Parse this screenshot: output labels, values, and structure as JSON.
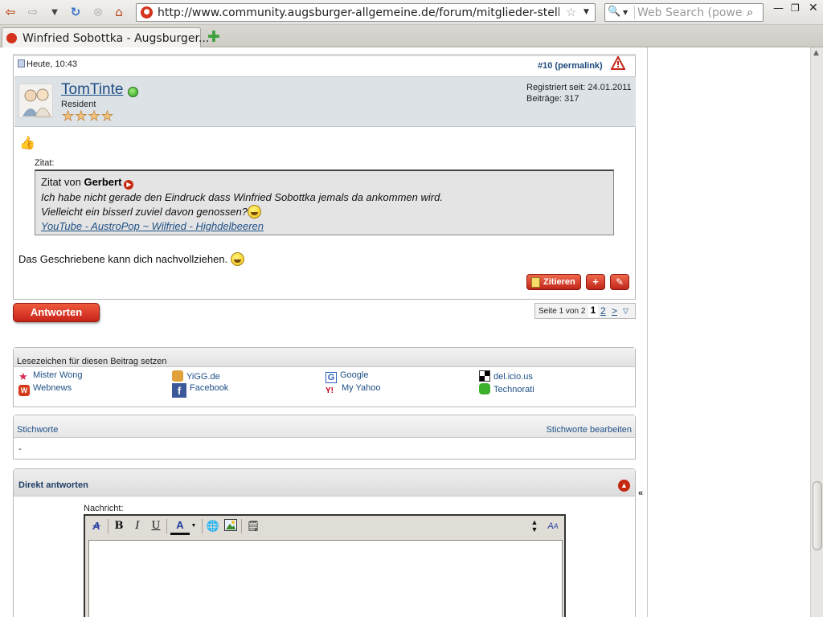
{
  "browser": {
    "url": "http://www.community.augsburger-allgemeine.de/forum/mitglieder-stellen-sich",
    "search_placeholder": "Web Search (powered",
    "tab_title": "Winfried Sobottka - Augsburger..."
  },
  "post": {
    "date": "Heute, 10:43",
    "number": "#10 (permalink)",
    "username": "TomTinte",
    "rank": "Resident",
    "stars": "★★★★",
    "registered": "Registriert seit: 24.01.2011",
    "posts": "Beiträge: 317",
    "quote_intro": "Zitat:",
    "quote_author_prefix": "Zitat von ",
    "quote_author": "Gerbert",
    "quote_line_1": "Ich habe nicht gerade den Eindruck dass Winfried Sobottka jemals da ankommen wird.",
    "quote_line_2": "Vielleicht ein bisserl zuviel davon genossen?",
    "quote_link": "YouTube - AustroPop ~ Wilfried - Highdelbeeren",
    "text": "Das Geschriebene kann dich nachvollziehen.",
    "quote_button": "Zitieren"
  },
  "reply_button": "Antworten",
  "pager": {
    "label": "Seite 1 von 2",
    "current": "1",
    "next_page": "2",
    "next": ">"
  },
  "bookmarks": {
    "title": "Lesezeichen für diesen Beitrag setzen",
    "items": [
      {
        "label": "Mister Wong",
        "icon": "mister-wong-icon",
        "color": "#d62a52"
      },
      {
        "label": "YiGG.de",
        "icon": "yigg-icon",
        "color": "#d08a2a"
      },
      {
        "label": "Google",
        "icon": "google-icon",
        "color": "#2d5fb8"
      },
      {
        "label": "del.icio.us",
        "icon": "delicious-icon",
        "color": "#000000"
      },
      {
        "label": "Webnews",
        "icon": "webnews-icon",
        "color": "#d63a1a"
      },
      {
        "label": "Facebook",
        "icon": "facebook-icon",
        "color": "#3b5998"
      },
      {
        "label": "My Yahoo",
        "icon": "yahoo-icon",
        "color": "#c4001a"
      },
      {
        "label": "Technorati",
        "icon": "technorati-icon",
        "color": "#3cb02a"
      }
    ]
  },
  "tags": {
    "title": "Stichworte",
    "edit": "Stichworte bearbeiten",
    "value": "-"
  },
  "quick_reply": {
    "title": "Direkt antworten",
    "label": "Nachricht:"
  }
}
